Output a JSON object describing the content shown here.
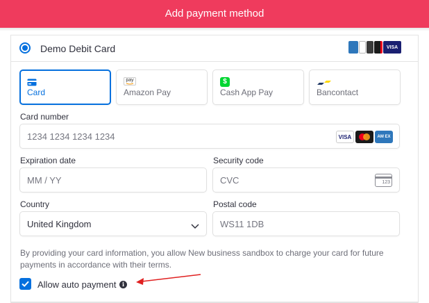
{
  "header": {
    "title": "Add payment method"
  },
  "method": {
    "label": "Demo Debit Card",
    "selected": true
  },
  "card_logos": [
    "amex-logo",
    "diners-logo",
    "discover-logo",
    "mastercard-logo",
    "visa-logo"
  ],
  "card_logo_texts": {
    "visa": "VISA"
  },
  "tabs": [
    {
      "label": "Card",
      "icon": "card-icon",
      "selected": true
    },
    {
      "label": "Amazon Pay",
      "icon": "amazon-pay-icon",
      "icon_text": "pay",
      "selected": false
    },
    {
      "label": "Cash App Pay",
      "icon": "cash-app-icon",
      "icon_text": "$",
      "selected": false
    },
    {
      "label": "Bancontact",
      "icon": "bancontact-icon",
      "selected": false
    }
  ],
  "form": {
    "card_number": {
      "label": "Card number",
      "placeholder": "1234 1234 1234 1234"
    },
    "card_brands": {
      "visa": "VISA",
      "mastercard": "",
      "amex": "AM EX"
    },
    "expiration": {
      "label": "Expiration date",
      "placeholder": "MM / YY"
    },
    "security": {
      "label": "Security code",
      "placeholder": "CVC",
      "icon_text": "123"
    },
    "country": {
      "label": "Country",
      "value": "United Kingdom"
    },
    "postal": {
      "label": "Postal code",
      "placeholder": "WS11 1DB"
    }
  },
  "notice": "By providing your card information, you allow New business sandbox to charge your card for future payments in accordance with their terms.",
  "auto_payment": {
    "label": "Allow auto payment",
    "checked": true,
    "info_glyph": "i"
  },
  "colors": {
    "header": "#ef3b5d",
    "accent": "#0570de",
    "annotation_arrow": "#e02020"
  }
}
